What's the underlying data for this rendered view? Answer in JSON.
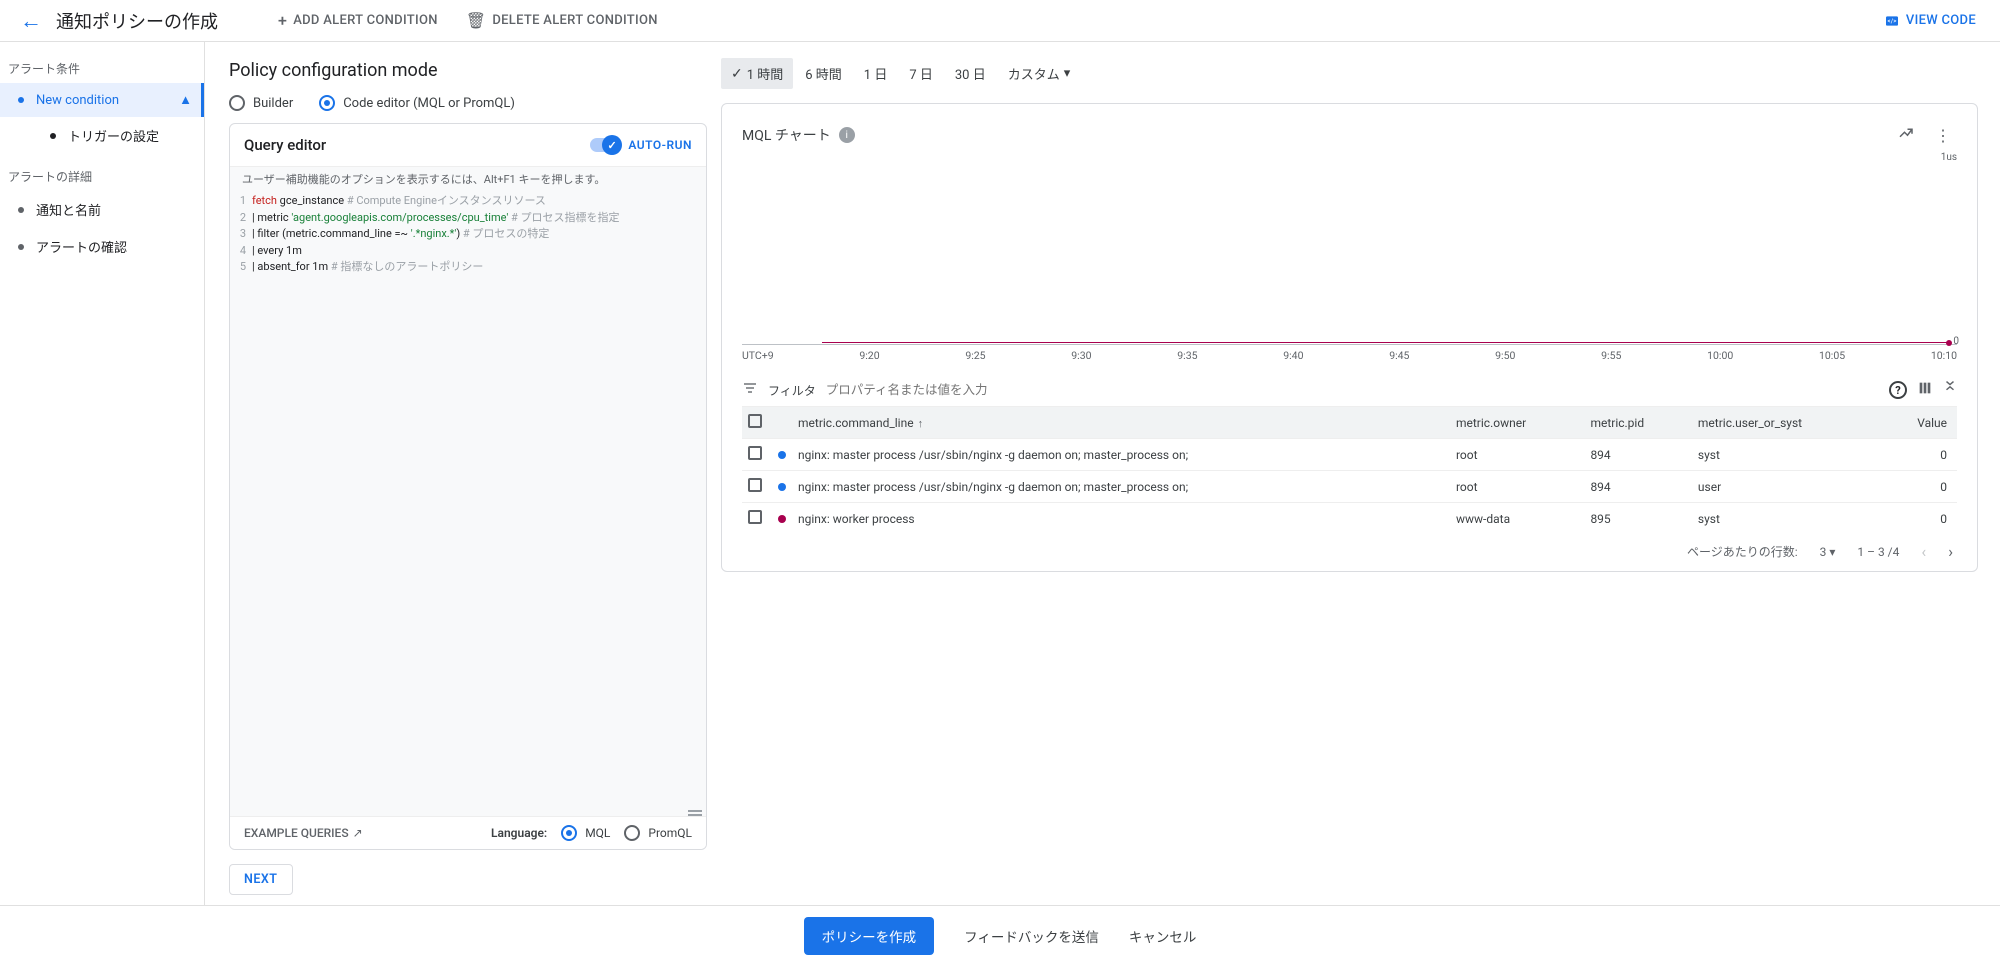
{
  "header": {
    "title": "通知ポリシーの作成",
    "add_condition": "ADD ALERT CONDITION",
    "delete_condition": "DELETE ALERT CONDITION",
    "view_code": "VIEW CODE"
  },
  "sidebar": {
    "section_conditions": "アラート条件",
    "new_condition": "New condition",
    "trigger_config": "トリガーの設定",
    "section_details": "アラートの詳細",
    "notification_name": "通知と名前",
    "alert_confirm": "アラートの確認"
  },
  "config": {
    "title": "Policy configuration mode",
    "builder": "Builder",
    "code_editor": "Code editor (MQL or PromQL)",
    "query_editor": "Query editor",
    "auto_run": "AUTO-RUN",
    "hint": "ユーザー補助機能のオプションを表示するには、Alt+F1 キーを押します。",
    "code_lines": [
      {
        "n": "1",
        "kw": "fetch",
        "a": " gce_instance ",
        "cm": "# Compute Engineインスタンスリソース"
      },
      {
        "n": "2",
        "pipe": "| metric ",
        "str": "'agent.googleapis.com/processes/cpu_time'",
        "cm": " # プロセス指標を指定"
      },
      {
        "n": "3",
        "pipe": "| filter (metric.command_line =~ ",
        "str": "'.*nginx.*'",
        "pipe2": ")",
        "cm": " # プロセスの特定"
      },
      {
        "n": "4",
        "pipe": "| every 1m"
      },
      {
        "n": "5",
        "pipe": "| absent_for 1m ",
        "cm": "# 指標なしのアラートポリシー"
      }
    ],
    "example_queries": "EXAMPLE QUERIES",
    "language_label": "Language:",
    "lang_mql": "MQL",
    "lang_promql": "PromQL",
    "next": "NEXT"
  },
  "chart": {
    "time_options": [
      "1 時間",
      "6 時間",
      "1 日",
      "7 日",
      "30 日",
      "カスタム"
    ],
    "title": "MQL チャート",
    "y_max": "1us",
    "zero": "0",
    "x_ticks": [
      "UTC+9",
      "9:20",
      "9:25",
      "9:30",
      "9:35",
      "9:40",
      "9:45",
      "9:50",
      "9:55",
      "10:00",
      "10:05",
      "10:10"
    ],
    "filter_label": "フィルタ",
    "filter_placeholder": "プロパティ名または値を入力",
    "columns": [
      "metric.command_line",
      "metric.owner",
      "metric.pid",
      "metric.user_or_syst",
      "Value"
    ],
    "rows": [
      {
        "color": "#1a73e8",
        "cmd": "nginx: master process /usr/sbin/nginx -g daemon on; master_process on;",
        "owner": "root",
        "pid": "894",
        "uos": "syst",
        "val": "0"
      },
      {
        "color": "#1a73e8",
        "cmd": "nginx: master process /usr/sbin/nginx -g daemon on; master_process on;",
        "owner": "root",
        "pid": "894",
        "uos": "user",
        "val": "0"
      },
      {
        "color": "#a8004e",
        "cmd": "nginx: worker process",
        "owner": "www-data",
        "pid": "895",
        "uos": "syst",
        "val": "0"
      }
    ],
    "rows_per_page_label": "ページあたりの行数:",
    "rows_per_page": "3",
    "range": "1 – 3 /4"
  },
  "footer": {
    "create": "ポリシーを作成",
    "feedback": "フィードバックを送信",
    "cancel": "キャンセル"
  },
  "chart_data": {
    "type": "line",
    "title": "MQL チャート",
    "x": [
      "9:20",
      "9:25",
      "9:30",
      "9:35",
      "9:40",
      "9:45",
      "9:50",
      "9:55",
      "10:00",
      "10:05",
      "10:10"
    ],
    "series": [
      {
        "name": "nginx: master process (root, syst)",
        "values": [
          0,
          0,
          0,
          0,
          0,
          0,
          0,
          0,
          0,
          0,
          0
        ]
      },
      {
        "name": "nginx: master process (root, user)",
        "values": [
          0,
          0,
          0,
          0,
          0,
          0,
          0,
          0,
          0,
          0,
          0
        ]
      },
      {
        "name": "nginx: worker process (www-data, syst)",
        "values": [
          0,
          0,
          0,
          0,
          0,
          0,
          0,
          0,
          0,
          0,
          0
        ]
      }
    ],
    "ylabel": "",
    "ylim": [
      0,
      1
    ],
    "y_unit": "us"
  }
}
